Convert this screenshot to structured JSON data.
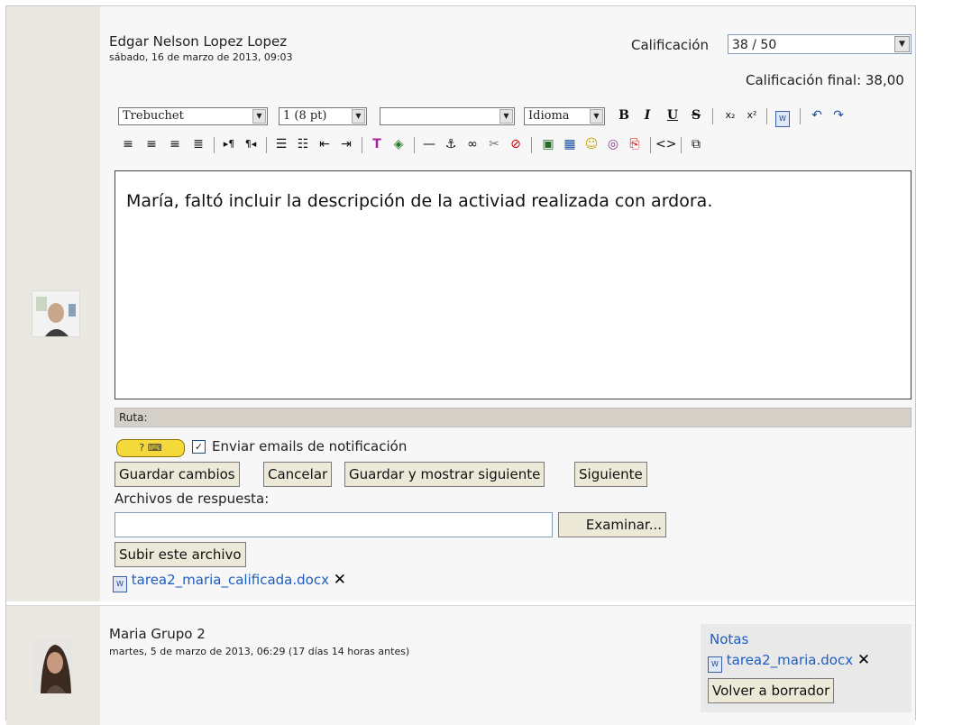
{
  "grader": {
    "name": "Edgar Nelson Lopez Lopez",
    "date": "sábado, 16 de marzo de 2013, 09:03",
    "grade_label": "Calificación",
    "grade_value": "38 / 50",
    "final_grade": "Calificación final: 38,00"
  },
  "toolbar": {
    "font_family": "Trebuchet",
    "font_size": "1 (8 pt)",
    "font_style": "",
    "language": "Idioma",
    "bold": "B",
    "italic": "I",
    "underline": "U",
    "strike": "S"
  },
  "editor": {
    "text": "María, faltó incluir la descripción de la activiad realizada con ardora."
  },
  "path_label": "Ruta:",
  "notify_label": "Enviar emails de notificación",
  "buttons": {
    "save": "Guardar cambios",
    "cancel": "Cancelar",
    "save_next": "Guardar y mostrar siguiente",
    "next": "Siguiente",
    "browse": "Examinar...",
    "upload": "Subir este archivo",
    "revert": "Volver a borrador"
  },
  "response_files_label": "Archivos de respuesta:",
  "response_file": "tarea2_maria_calificada.docx",
  "student": {
    "name": "Maria Grupo 2",
    "date": "martes, 5 de marzo de 2013, 06:29 (17 días 14 horas antes)",
    "notes_label": "Notas",
    "file": "tarea2_maria.docx"
  },
  "icons": [
    "avatar-grader",
    "avatar-student",
    "docx-icon",
    "delete-icon",
    "help-icon",
    "checkbox-icon"
  ]
}
